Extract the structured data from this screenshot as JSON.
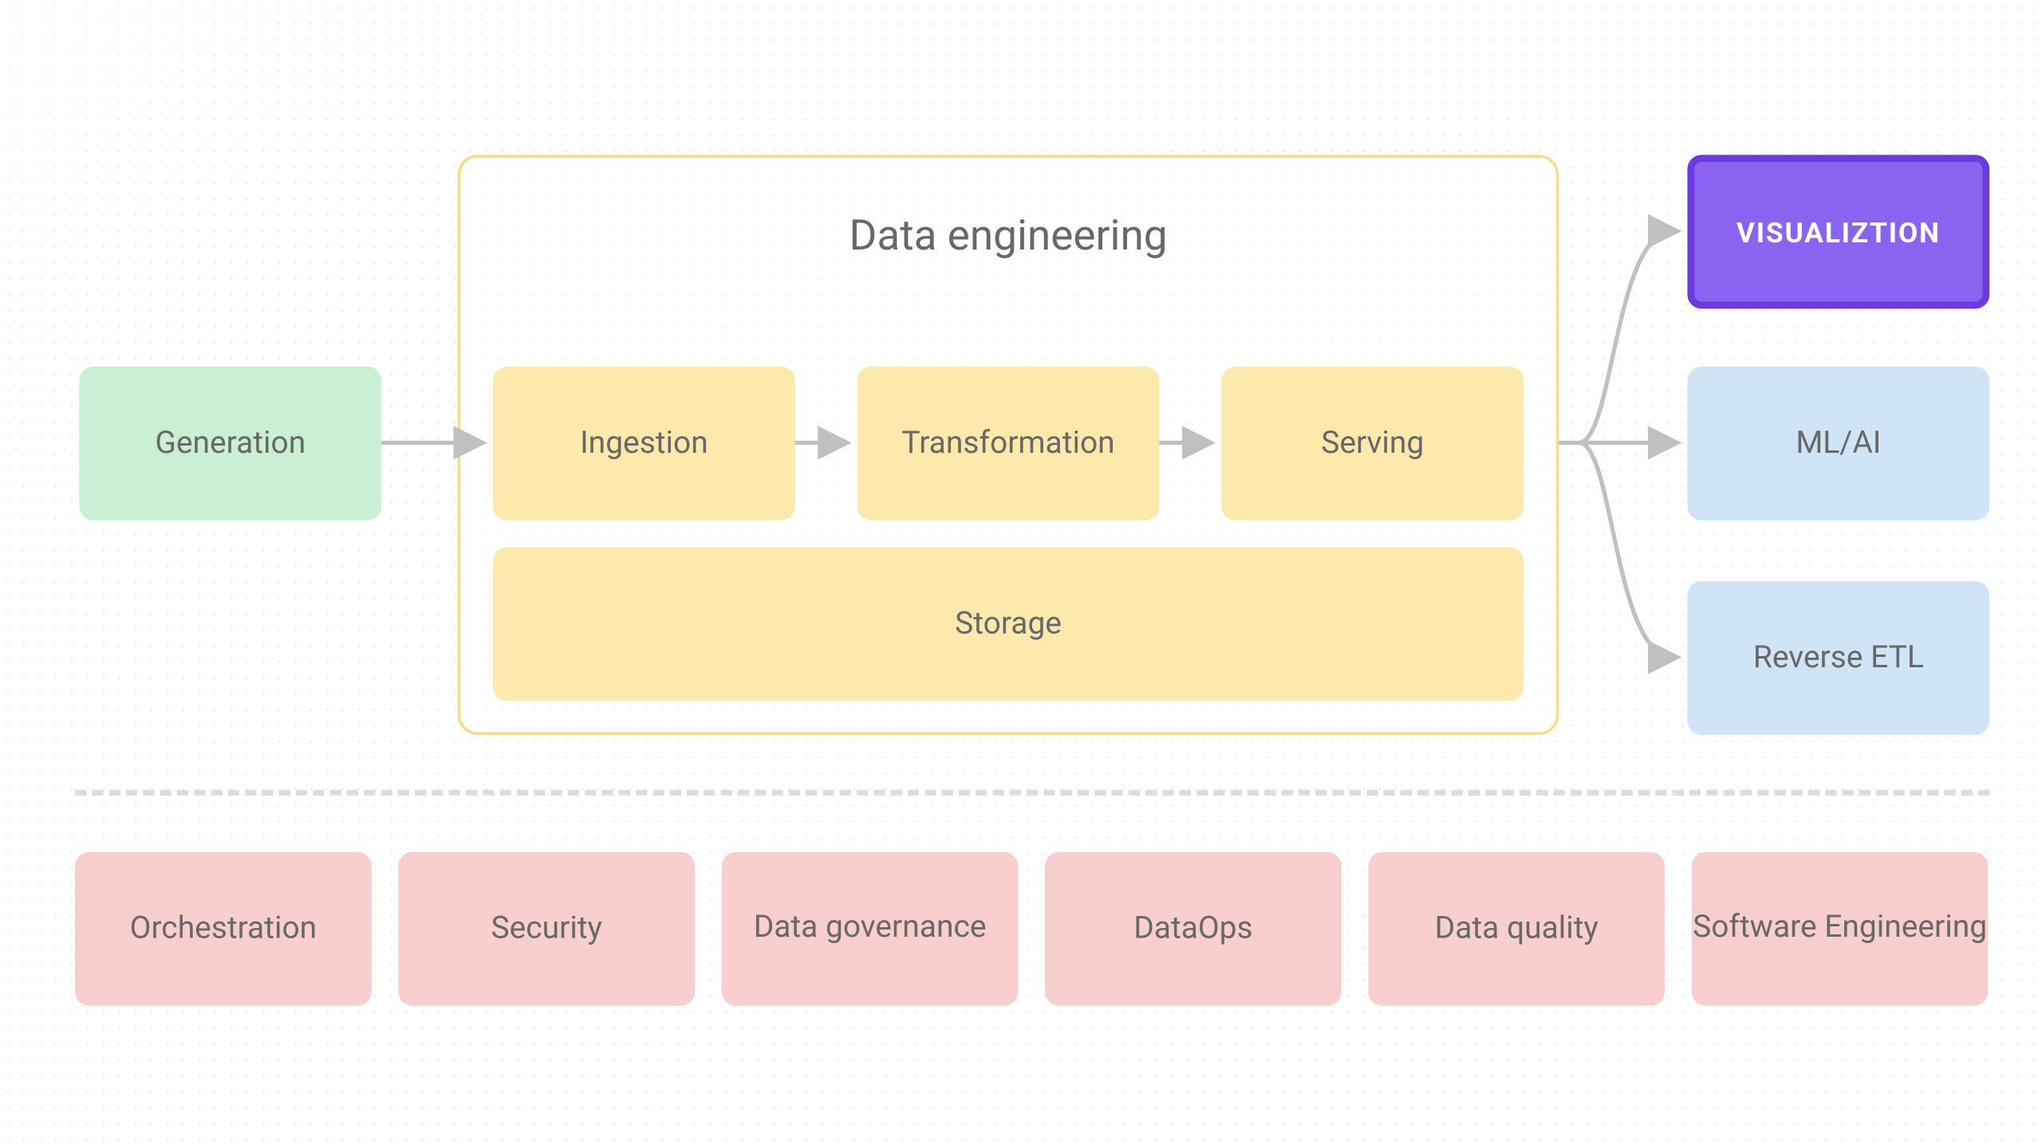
{
  "diagram": {
    "generation": "Generation",
    "data_engineering": {
      "title": "Data engineering",
      "ingestion": "Ingestion",
      "transformation": "Transformation",
      "serving": "Serving",
      "storage": "Storage"
    },
    "outputs": {
      "visualization": "VISUALIZTION",
      "ml_ai": "ML/AI",
      "reverse_etl": "Reverse ETL"
    },
    "foundation": {
      "orchestration": "Orchestration",
      "security": "Security",
      "data_governance": "Data governance",
      "dataops": "DataOps",
      "data_quality": "Data quality",
      "software_engineering": "Software Engineering"
    }
  }
}
